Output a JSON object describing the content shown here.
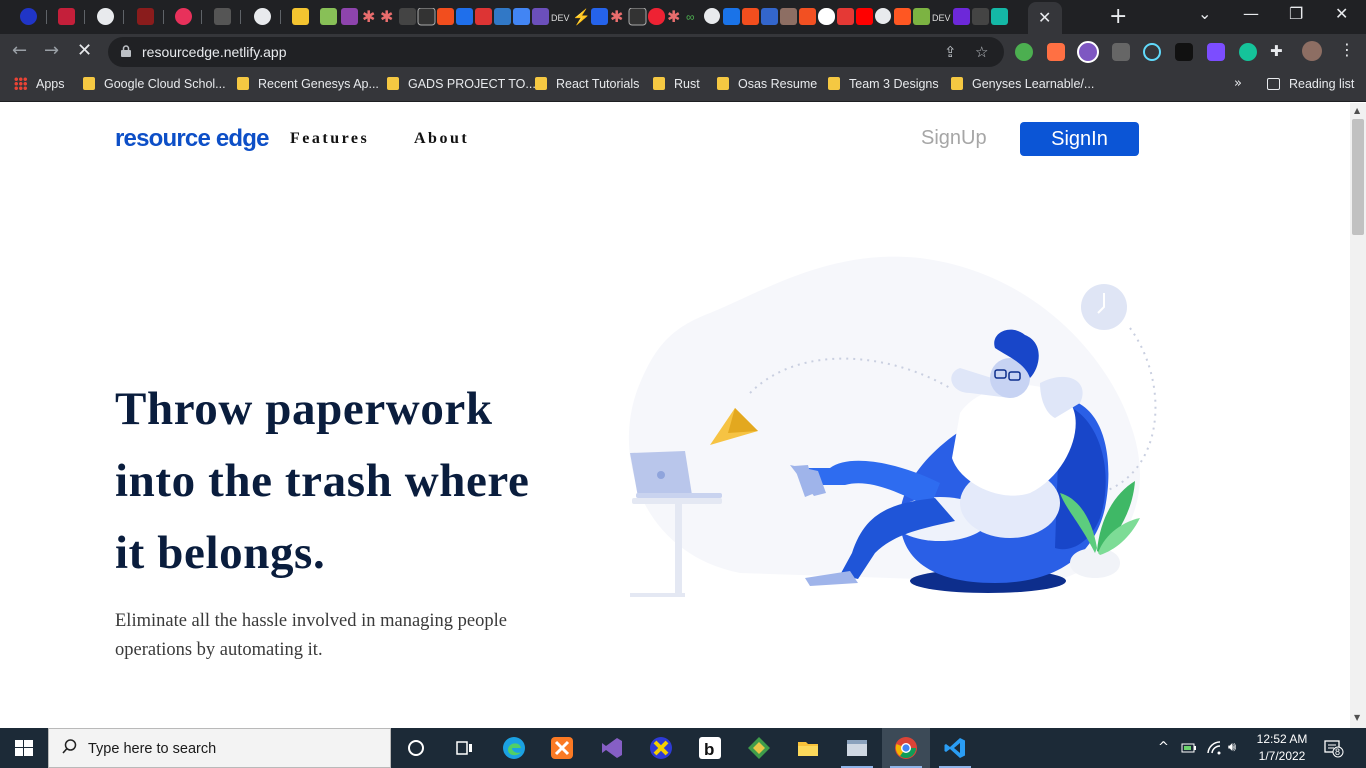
{
  "browser": {
    "tab_close": "✕",
    "new_tab": "+",
    "window_controls": [
      "⌄",
      "—",
      "❐",
      "✕"
    ],
    "url": "resourcedge.netlify.app",
    "bookmarks": [
      {
        "label": "Apps",
        "icon": "apps-grid-icon"
      },
      {
        "label": "Google Cloud Schol...",
        "icon": "folder-icon"
      },
      {
        "label": "Recent Genesys Ap...",
        "icon": "folder-icon"
      },
      {
        "label": "GADS PROJECT TO...",
        "icon": "folder-icon"
      },
      {
        "label": "React Tutorials",
        "icon": "folder-icon"
      },
      {
        "label": "Rust",
        "icon": "folder-icon"
      },
      {
        "label": "Osas Resume",
        "icon": "folder-icon"
      },
      {
        "label": "Team 3 Designs",
        "icon": "folder-icon"
      },
      {
        "label": "Genyses Learnable/...",
        "icon": "folder-icon"
      }
    ],
    "overflow": "»",
    "reading_list": "Reading list"
  },
  "site": {
    "logo": "resource edge",
    "nav": {
      "features": "Features",
      "about": "About"
    },
    "signup": "SignUp",
    "signin": "SignIn",
    "hero": {
      "headline": "Throw paperwork into the trash where it belongs.",
      "subtext": "Eliminate all the hassle involved in managing people operations by automating it."
    },
    "colors": {
      "brand": "#0b55d6",
      "headline": "#0a1d3d"
    }
  },
  "taskbar": {
    "search_placeholder": "Type here to search",
    "time": "12:52 AM",
    "date": "1/7/2022",
    "notifications": "8"
  }
}
